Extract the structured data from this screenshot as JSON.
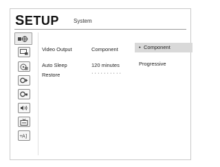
{
  "header": {
    "title_first": "S",
    "title_rest": "ETUP",
    "subtitle": "System"
  },
  "sidebar": {
    "items": [
      {
        "icon": "system-icon",
        "active": true
      },
      {
        "icon": "display-icon",
        "active": false
      },
      {
        "icon": "audio-disc-icon",
        "active": false
      },
      {
        "icon": "language-icon",
        "active": false
      },
      {
        "icon": "dvd-icon",
        "active": false
      },
      {
        "icon": "speaker-icon",
        "active": false
      },
      {
        "icon": "parental-tv-icon",
        "active": false
      },
      {
        "icon": "ratings-icon",
        "active": false
      }
    ]
  },
  "settings": [
    {
      "label": "Video Output",
      "value": "Component"
    },
    {
      "label": "Auto Sleep",
      "value": "120 minutes"
    },
    {
      "label": "Restore",
      "value": "··········"
    }
  ],
  "options": {
    "items": [
      {
        "label": "Component",
        "selected": true,
        "bullet": "•"
      },
      {
        "label": "Progressive",
        "selected": false,
        "bullet": ""
      }
    ]
  },
  "colors": {
    "highlight": "#d9d9d9",
    "border": "#c9c9c9",
    "text": "#222222"
  }
}
